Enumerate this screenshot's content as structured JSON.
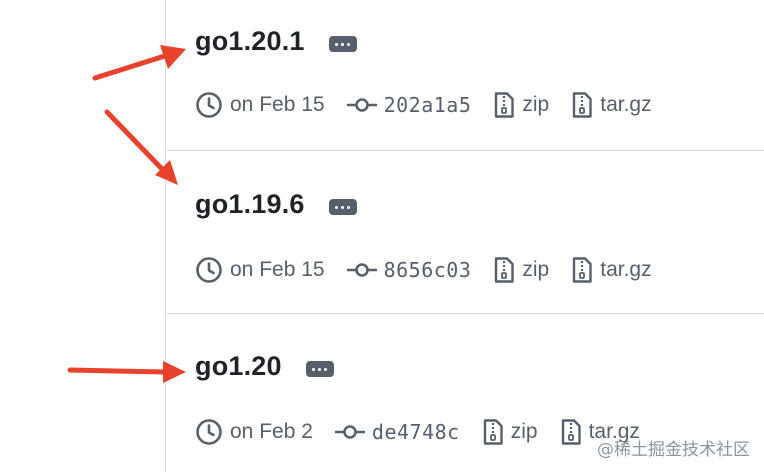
{
  "colors": {
    "arrow": "#e8412c",
    "muted_text": "#57606a",
    "divider": "#d8dee4",
    "title_text": "#1f2328"
  },
  "tags": [
    {
      "name": "go1.20.1",
      "date": "on Feb 15",
      "commit": "202a1a5",
      "zip_label": "zip",
      "targz_label": "tar.gz",
      "icons": [
        "clock-icon",
        "commit-icon",
        "file-zip-icon",
        "file-zip-icon",
        "kebab-horizontal-icon"
      ]
    },
    {
      "name": "go1.19.6",
      "date": "on Feb 15",
      "commit": "8656c03",
      "zip_label": "zip",
      "targz_label": "tar.gz",
      "icons": [
        "clock-icon",
        "commit-icon",
        "file-zip-icon",
        "file-zip-icon",
        "kebab-horizontal-icon"
      ]
    },
    {
      "name": "go1.20",
      "date": "on Feb 2",
      "commit": "de4748c",
      "zip_label": "zip",
      "targz_label": "tar.gz",
      "icons": [
        "clock-icon",
        "commit-icon",
        "file-zip-icon",
        "file-zip-icon",
        "kebab-horizontal-icon"
      ]
    }
  ],
  "annotations": {
    "arrow_count": 3
  },
  "watermark": "@稀土掘金技术社区"
}
